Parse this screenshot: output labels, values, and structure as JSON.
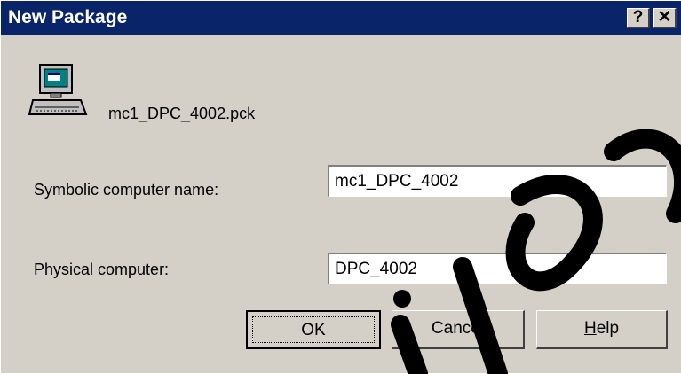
{
  "window": {
    "title": "New Package",
    "help_button": "?",
    "close_button": "✕"
  },
  "package": {
    "icon": "computer-icon",
    "file_name": "mc1_DPC_4002.pck"
  },
  "form": {
    "symbolic_label": "Symbolic computer name:",
    "symbolic_value": "mc1_DPC_4002",
    "physical_label": "Physical computer:",
    "physical_value": "DPC_4002"
  },
  "buttons": {
    "ok": "OK",
    "cancel": "Cancel",
    "help_mnemonic": "H",
    "help_rest": "elp"
  },
  "colors": {
    "titlebar": "#0a246a",
    "dialog_face": "#d4d0c8",
    "watermark": "#000000"
  }
}
